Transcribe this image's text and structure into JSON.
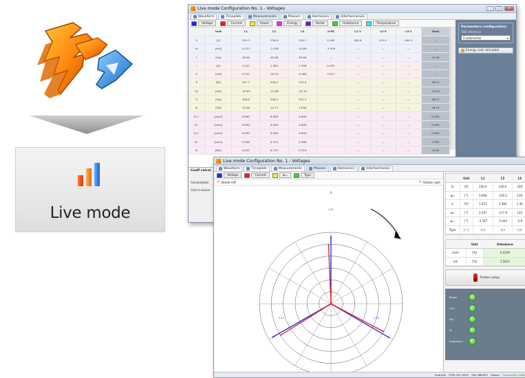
{
  "launcher": {
    "logo_icon": "lightning-arrow-logo-icon",
    "label": "Live mode",
    "label_icon": "bar-chart-icon"
  },
  "back_window": {
    "title": "Live mode Configuration No. 1 - Voltages",
    "tabs": [
      {
        "label": "Waveform",
        "icon": "waveform-icon"
      },
      {
        "label": "Timeplots",
        "icon": "timeplot-icon"
      },
      {
        "label": "Measurements",
        "icon": "table-icon",
        "active": true
      },
      {
        "label": "Phasors",
        "icon": "phasor-icon"
      },
      {
        "label": "Harmonics",
        "icon": "harmonics-icon"
      },
      {
        "label": "Interharmonics",
        "icon": "interharmonics-icon"
      }
    ],
    "legend": [
      {
        "label": "Voltage",
        "color": "#1f2be0"
      },
      {
        "label": "Current",
        "color": "#e01f1f"
      },
      {
        "label": "Power",
        "color": "#f2ef2c"
      },
      {
        "label": "Energy",
        "color": "#e92fd6"
      },
      {
        "label": "Factor",
        "color": "#6a1fc9"
      },
      {
        "label": "Unbalance",
        "color": "#3cd32d"
      },
      {
        "label": "Temperature",
        "color": "#36e6ef"
      }
    ],
    "table": {
      "headers": [
        "",
        "Unit",
        "L1",
        "L2",
        "L3",
        "0-PE",
        "L1-2",
        "L2-3",
        "L3-1",
        "Total"
      ],
      "rows": [
        {
          "name": "U",
          "unit": "[V]",
          "v": [
            "229.3",
            "230.6",
            "229.1",
            "0.163",
            "404.8",
            "415.2",
            "404.3",
            "---"
          ],
          "bg": "#eef1fb"
        },
        {
          "name": "U₂",
          "unit": "[mV]",
          "v": [
            "-0.511",
            "-2.416",
            "-0.040",
            "-1.558",
            "---",
            "---",
            "---",
            "---"
          ],
          "bg": "#eef1fb"
        },
        {
          "name": "f",
          "unit": "[Hz]",
          "v": [
            "49.96",
            "49.96",
            "49.96",
            "---",
            "---",
            "---",
            "---",
            "49.96"
          ],
          "bg": "#eef1fb"
        },
        {
          "name": "I",
          "unit": "[A]",
          "v": [
            "1.413",
            "1.384",
            "1.348",
            "0.052",
            "---",
            "---",
            "---",
            "---"
          ],
          "bg": "#fbeeee"
        },
        {
          "name": "I₂",
          "unit": "[mA]",
          "v": [
            "47.03",
            "-59.29",
            "-0.462",
            "3.517",
            "---",
            "---",
            "---",
            "---"
          ],
          "bg": "#fbeeee"
        },
        {
          "name": "P",
          "unit": "[W]",
          "v": [
            "327.7",
            "330.2",
            "322.0",
            "",
            "---",
            "---",
            "---",
            "980.0"
          ],
          "bg": "#f4f4df"
        },
        {
          "name": "Q₁",
          "unit": "[var]",
          "v": [
            "-10.83",
            "-14.08",
            "-15.10",
            "",
            "---",
            "---",
            "---",
            "-40.03"
          ],
          "bg": "#f4f4df"
        },
        {
          "name": "S",
          "unit": "[VA]",
          "v": [
            "328.0",
            "330.5",
            "322.4",
            "",
            "---",
            "---",
            "---",
            "981.3"
          ],
          "bg": "#f4f4df"
        },
        {
          "name": "Sₙ",
          "unit": "[VA]",
          "v": [
            "15.28",
            "14.77",
            "13.80",
            "",
            "---",
            "---",
            "---",
            "46.10"
          ],
          "bg": "#f4f4df"
        },
        {
          "name": "Eₚ+",
          "unit": "[varh]",
          "v": [
            "0.000",
            "0.000",
            "0.000",
            "",
            "---",
            "---",
            "---",
            "0.000"
          ],
          "bg": "#f9eaf6"
        },
        {
          "name": "Eₚ-",
          "unit": "[varh]",
          "v": [
            "0.000",
            "0.000",
            "0.000",
            "",
            "---",
            "---",
            "---",
            "0.000"
          ],
          "bg": "#f9eaf6"
        },
        {
          "name": "Eₚ+",
          "unit": "[varh]",
          "v": [
            "0.000",
            "0.000",
            "0.000",
            "",
            "---",
            "---",
            "---",
            "0.000"
          ],
          "bg": "#f9eaf6"
        },
        {
          "name": "Eₚ-",
          "unit": "[varh]",
          "v": [
            "5.348",
            "0.255",
            "0.380",
            "",
            "---",
            "---",
            "---",
            "5.983"
          ],
          "bg": "#f9eaf6"
        },
        {
          "name": "Eₛ",
          "unit": "[Wh]",
          "v": [
            "0.025",
            "0.212",
            "0.124",
            "",
            "---",
            "---",
            "---",
            "24.62"
          ],
          "bg": "#f9eaf6"
        }
      ]
    },
    "side_panel": {
      "title": "Parameters configuration",
      "sub": "THD reference",
      "select": "Fundamental",
      "button": "Energy cost calculator"
    },
    "bottom_labels": [
      "Coeff calcul",
      "Consumption",
      "Cost in source"
    ]
  },
  "front_window": {
    "title": "Live mode Configuration No. 1 - Voltages",
    "tabs": [
      {
        "label": "Waveform",
        "icon": "waveform-icon"
      },
      {
        "label": "Timeplots",
        "icon": "timeplot-icon"
      },
      {
        "label": "Measurements",
        "icon": "table-icon"
      },
      {
        "label": "Phasors",
        "icon": "phasor-icon",
        "active": true
      },
      {
        "label": "Harmonics",
        "icon": "harmonics-icon"
      },
      {
        "label": "Interharmonics",
        "icon": "interharmonics-icon"
      }
    ],
    "legend": [
      {
        "label": "Voltage",
        "color": "#1f2be0"
      },
      {
        "label": "Current",
        "color": "#e01f1f"
      },
      {
        "label": "φᵤ,ᵢ",
        "color": "#f2ef2c"
      },
      {
        "label": "Type",
        "color": "#3cd32d"
      }
    ],
    "rotate_left": "Rotate left",
    "rotate_right": "Rotate right",
    "phasor": {
      "top_label": "0",
      "labels": [
        "1.41",
        "2.35",
        "2.34",
        "2.35"
      ],
      "voltage_color": "#2a2fd8",
      "current_color": "#d82a2a"
    },
    "table1": {
      "headers": [
        "",
        "Unit",
        "L1",
        "L2",
        "L3"
      ],
      "rows": [
        {
          "name": "U₁",
          "unit": "[V]",
          "v": [
            "230.4",
            "230.0",
            "228"
          ]
        },
        {
          "name": "φᵤ₁",
          "unit": "[°]",
          "v": [
            "0.000",
            "-120.2",
            "119"
          ]
        },
        {
          "name": "I₁",
          "unit": "[A]",
          "v": [
            "1.413",
            "1.384",
            "1.34"
          ]
        },
        {
          "name": "φᵢ₁",
          "unit": "[°]",
          "v": [
            "2.347",
            "-117.9",
            "122"
          ]
        },
        {
          "name": "φᵤ,ᵢ",
          "unit": "[°]",
          "v": [
            "-2.347",
            "-2.443",
            "-2.8"
          ]
        },
        {
          "name": "Type",
          "unit": "[---]",
          "v": [
            "+|+",
            "+|+",
            "+|+"
          ]
        }
      ]
    },
    "table2": {
      "headers": [
        "",
        "Unit",
        "Unbalance"
      ],
      "rows": [
        {
          "name": "U₂/U₁",
          "unit": "[%]",
          "v": "0.2229"
        },
        {
          "name": "I₂/I₁",
          "unit": "[%]",
          "v": "1.5623"
        }
      ]
    },
    "probes_button": "Probes setup",
    "indicators": [
      "Phase",
      "Curr.",
      "Vol.",
      "Pf.",
      "Frequency"
    ],
    "status": {
      "analyzer": "Analyzer",
      "model": "PQM-702 (AUF)",
      "sn": "S/N: BB0957",
      "status_label": "Status:",
      "status_value": "Connected (USB)"
    }
  }
}
